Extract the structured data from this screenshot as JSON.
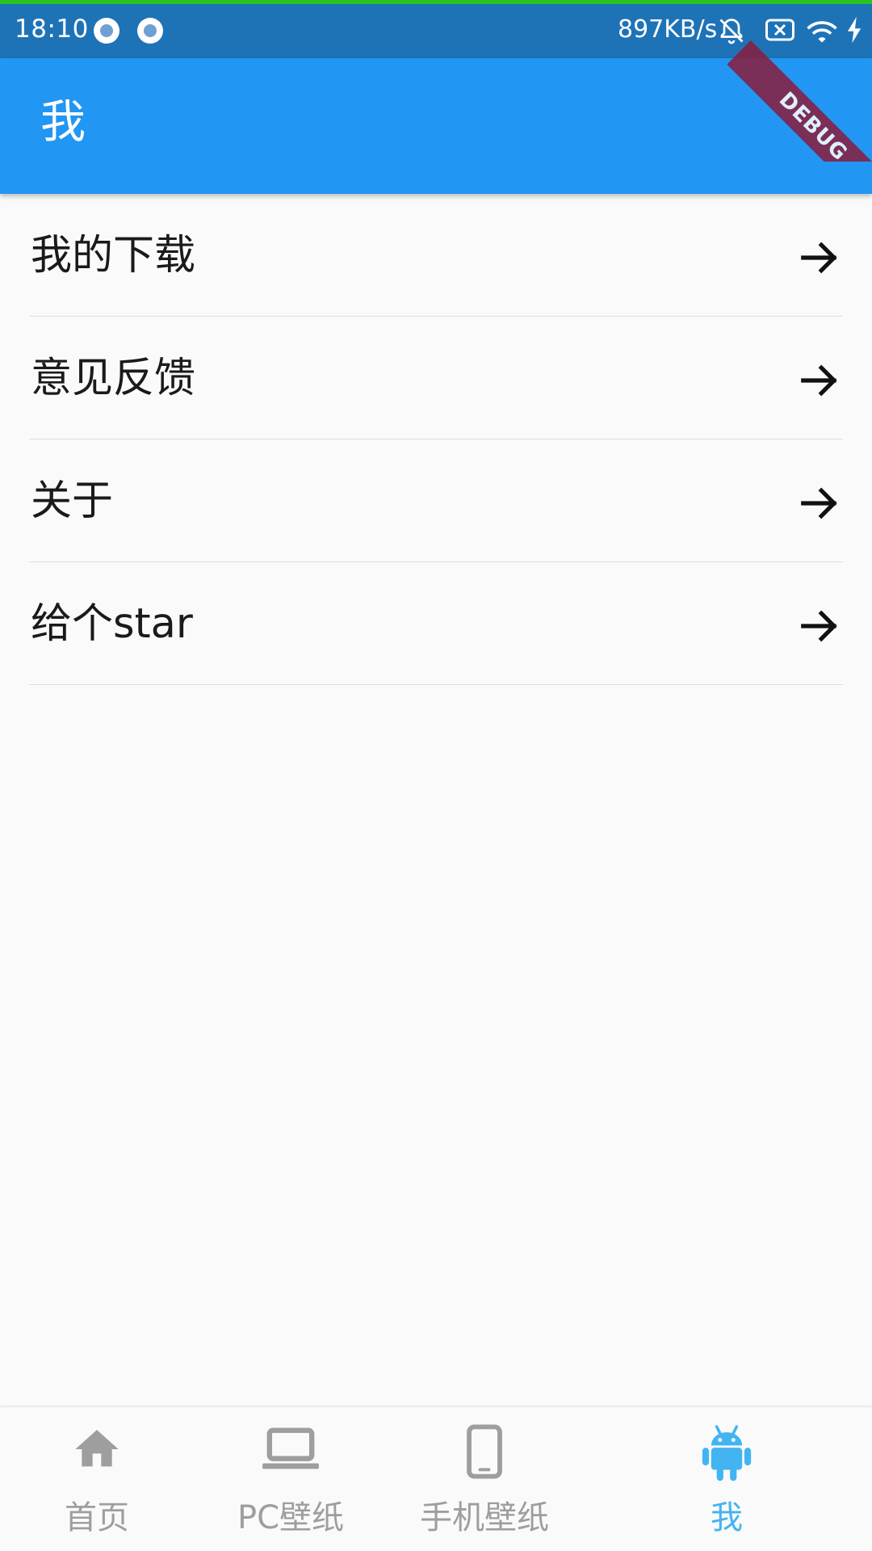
{
  "status_bar": {
    "time": "18:10",
    "network_speed": "897KB/s"
  },
  "debug_banner": "DEBUG",
  "app_bar": {
    "title": "我"
  },
  "menu": [
    {
      "label": "我的下载",
      "icon": "arrow-forward-icon"
    },
    {
      "label": "意见反馈",
      "icon": "arrow-forward-icon"
    },
    {
      "label": "关于",
      "icon": "arrow-forward-icon"
    },
    {
      "label": "给个star",
      "icon": "arrow-forward-icon"
    }
  ],
  "bottom_nav": {
    "active_index": 3,
    "items": [
      {
        "label": "首页",
        "icon": "home-icon"
      },
      {
        "label": "PC壁纸",
        "icon": "laptop-icon"
      },
      {
        "label": "手机壁纸",
        "icon": "phone-icon"
      },
      {
        "label": "我",
        "icon": "android-icon"
      }
    ]
  },
  "colors": {
    "status_bar": "#1e73b7",
    "app_bar": "#2196f3",
    "active_tab": "#42b4f2",
    "inactive_tab": "#9e9e9e",
    "debug_banner": "#8a1c3d"
  }
}
